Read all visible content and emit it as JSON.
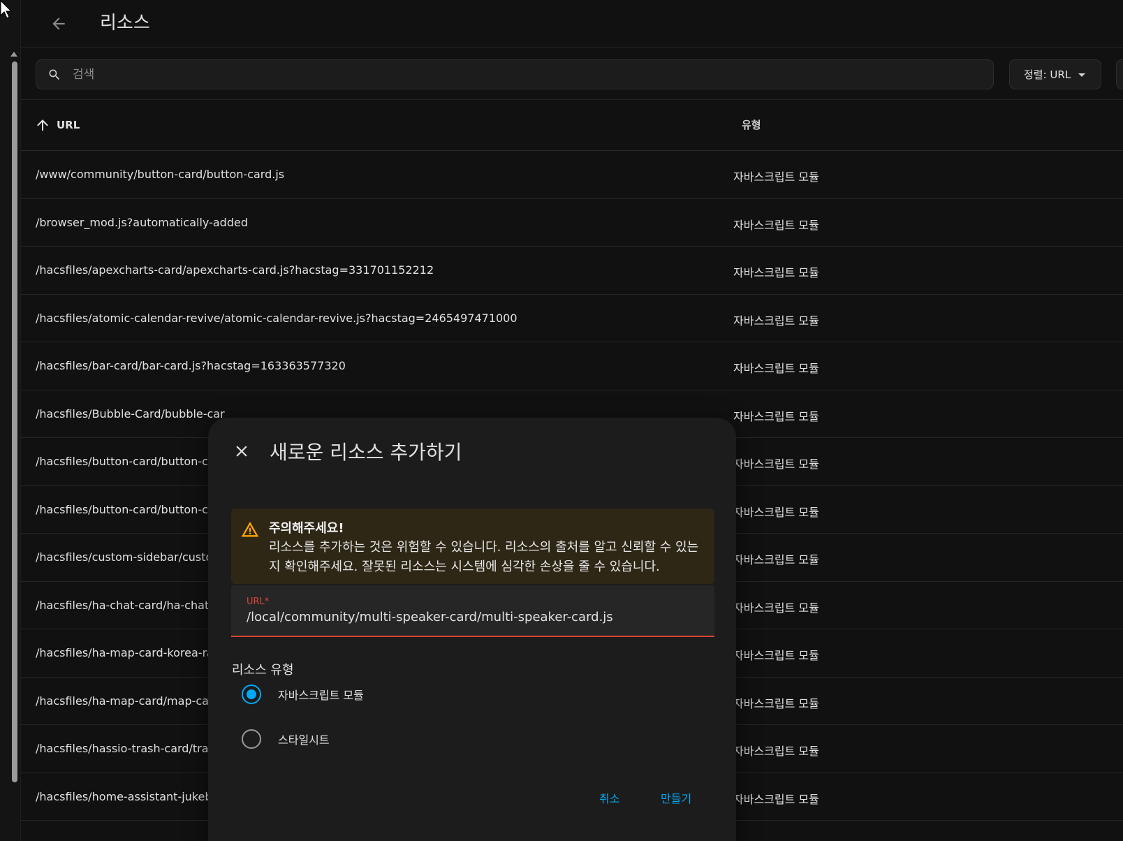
{
  "header": {
    "title": "리소스"
  },
  "search": {
    "placeholder": "검색"
  },
  "sort": {
    "label": "정렬: URL"
  },
  "table": {
    "headers": {
      "url": "URL",
      "type": "유형"
    },
    "rows": [
      {
        "url": "/www/community/button-card/button-card.js",
        "type": "자바스크립트 모듈"
      },
      {
        "url": "/browser_mod.js?automatically-added",
        "type": "자바스크립트 모듈"
      },
      {
        "url": "/hacsfiles/apexcharts-card/apexcharts-card.js?hacstag=331701152212",
        "type": "자바스크립트 모듈"
      },
      {
        "url": "/hacsfiles/atomic-calendar-revive/atomic-calendar-revive.js?hacstag=2465497471000",
        "type": "자바스크립트 모듈"
      },
      {
        "url": "/hacsfiles/bar-card/bar-card.js?hacstag=163363577320",
        "type": "자바스크립트 모듈"
      },
      {
        "url": "/hacsfiles/Bubble-Card/bubble-car",
        "type": "자바스크립트 모듈"
      },
      {
        "url": "/hacsfiles/button-card/button-ca",
        "type": "자바스크립트 모듈"
      },
      {
        "url": "/hacsfiles/button-card/button-ca",
        "type": "자바스크립트 모듈"
      },
      {
        "url": "/hacsfiles/custom-sidebar/custo",
        "type": "자바스크립트 모듈"
      },
      {
        "url": "/hacsfiles/ha-chat-card/ha-chat-",
        "type": "자바스크립트 모듈"
      },
      {
        "url": "/hacsfiles/ha-map-card-korea-rac",
        "type": "자바스크립트 모듈"
      },
      {
        "url": "/hacsfiles/ha-map-card/map-car",
        "type": "자바스크립트 모듈"
      },
      {
        "url": "/hacsfiles/hassio-trash-card/tras",
        "type": "자바스크립트 모듈"
      },
      {
        "url": "/hacsfiles/home-assistant-jukeb",
        "type": "자바스크립트 모듈"
      }
    ]
  },
  "dialog": {
    "title": "새로운 리소스 추가하기",
    "alert": {
      "title": "주의해주세요!",
      "body": "리소스를 추가하는 것은 위험할 수 있습니다. 리소스의 출처를 알고 신뢰할 수 있는지 확인해주세요. 잘못된 리소스는 시스템에 심각한 손상을 줄 수 있습니다."
    },
    "url_field": {
      "label": "URL*",
      "value": "/local/community/multi-speaker-card/multi-speaker-card.js"
    },
    "resource_type": {
      "label": "리소스 유형",
      "options": [
        {
          "label": "자바스크립트 모듈",
          "selected": true
        },
        {
          "label": "스타일시트",
          "selected": false
        }
      ]
    },
    "cancel_label": "취소",
    "create_label": "만들기"
  },
  "colors": {
    "accent": "#03a9f4",
    "error": "#db4437",
    "warning": "#ffa600",
    "background": "#111111",
    "dialog": "#1c1c1c"
  }
}
